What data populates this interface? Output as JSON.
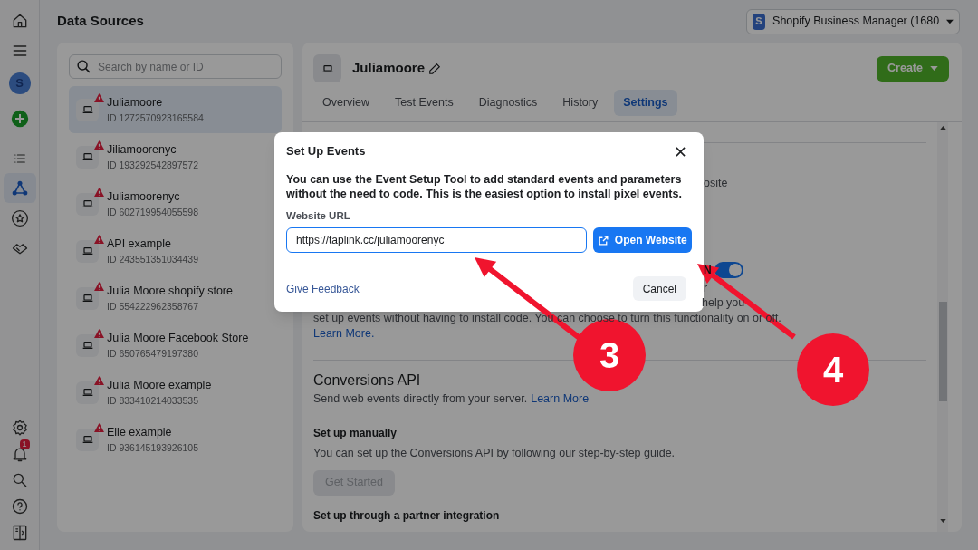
{
  "rail": {
    "top": [
      {
        "kind": "home",
        "selected": false
      },
      {
        "kind": "menu",
        "selected": false
      },
      {
        "kind": "avatar",
        "text": "S",
        "selected": false
      },
      {
        "kind": "create",
        "selected": false
      },
      {
        "kind": "list",
        "selected": false
      },
      {
        "kind": "network",
        "selected": true
      },
      {
        "kind": "star",
        "selected": false
      },
      {
        "kind": "handshake",
        "selected": false
      }
    ],
    "bottom": [
      {
        "kind": "settings",
        "selected": false
      },
      {
        "kind": "notifications",
        "badge": "1",
        "selected": false
      },
      {
        "kind": "search",
        "selected": false
      },
      {
        "kind": "help",
        "selected": false
      },
      {
        "kind": "panel",
        "selected": false
      }
    ]
  },
  "page_title": "Data Sources",
  "business": {
    "initial": "S",
    "name": "Shopify Business Manager (1680"
  },
  "sources": {
    "search_placeholder": "Search by name or ID",
    "items": [
      {
        "name": "Juliamoore",
        "id": "ID 1272570923165584",
        "warning": true,
        "selected": true
      },
      {
        "name": "Jiliamoorenyc",
        "id": "ID 193292542897572",
        "warning": true,
        "selected": false
      },
      {
        "name": "Juliamoorenyc",
        "id": "ID 602719954055598",
        "warning": true,
        "selected": false
      },
      {
        "name": "API example",
        "id": "ID 243551351034439",
        "warning": true,
        "selected": false
      },
      {
        "name": "Julia Moore shopify store",
        "id": "ID 554222962358767",
        "warning": true,
        "selected": false
      },
      {
        "name": "Julia Moore Facebook Store",
        "id": "ID 650765479197380",
        "warning": true,
        "selected": false
      },
      {
        "name": "Julia Moore example",
        "id": "ID 833410214033535",
        "warning": true,
        "selected": false
      },
      {
        "name": "Elle example",
        "id": "ID 936145193926105",
        "warning": true,
        "selected": false
      }
    ]
  },
  "detail": {
    "name": "Juliamoore",
    "create": "Create",
    "tabs": [
      {
        "label": "Overview",
        "selected": false
      },
      {
        "label": "Test Events",
        "selected": false
      },
      {
        "label": "Diagnostics",
        "selected": false
      },
      {
        "label": "History",
        "selected": false
      },
      {
        "label": "Settings",
        "selected": true
      }
    ],
    "fragment_1": "osite",
    "toggle_label": "N",
    "toggle_on": true,
    "fragment_2": "r",
    "fragment_3": "help you",
    "description": "set up events without having to install code. You can choose to turn this functionality on or off.",
    "learn_more": "Learn More.",
    "conversions": {
      "title": "Conversions API",
      "text": "Send web events directly from your server.",
      "link": "Learn More",
      "manual_title": "Set up manually",
      "manual_text": "You can set up the Conversions API by following our step-by-step guide.",
      "button": "Get Started",
      "button_disabled": true,
      "partner_title": "Set up through a partner integration"
    }
  },
  "modal": {
    "title": "Set Up Events",
    "text": "You can use the Event Setup Tool to add standard events and parameters without the need to code. This is the easiest option to install pixel events.",
    "field_label": "Website URL",
    "field_value": "https://taplink.cc/juliamoorenyc",
    "open_button": "Open Website",
    "feedback": "Give Feedback",
    "cancel": "Cancel"
  },
  "annotations": [
    {
      "label": "3"
    },
    {
      "label": "4"
    }
  ]
}
